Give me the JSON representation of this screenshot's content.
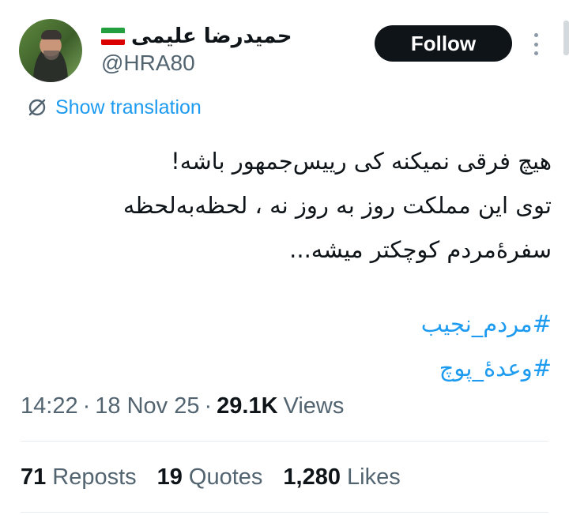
{
  "author": {
    "display_name": "حمیدرضا علیمی",
    "flag_icon": "iran-flag-icon",
    "handle": "@HRA80"
  },
  "follow_button": {
    "label": "Follow"
  },
  "more_icon": "more-vertical-icon",
  "translation": {
    "icon": "translate-icon",
    "label": "Show translation"
  },
  "tweet": {
    "lines": [
      "هیچ فرقی نمیکنه کی رییس‌جمهور باشه!",
      "توی این مملکت  روز به روز نه ، لحظه‌به‌لحظه",
      "سفرهٔ‌مردم کوچکتر میشه..."
    ],
    "hashtags": [
      "#مردم_نجیب",
      "#وعدهٔ_پوچ"
    ]
  },
  "meta": {
    "time": "14:22",
    "separator": "·",
    "date": "18 Nov 25",
    "views_count": "29.1K",
    "views_label": "Views"
  },
  "stats": [
    {
      "count": "71",
      "label": "Reposts"
    },
    {
      "count": "19",
      "label": "Quotes"
    },
    {
      "count": "1,280",
      "label": "Likes"
    }
  ],
  "colors": {
    "link": "#1d9bf0",
    "text": "#0f1419",
    "muted": "#536471",
    "button_bg": "#0f1419"
  }
}
